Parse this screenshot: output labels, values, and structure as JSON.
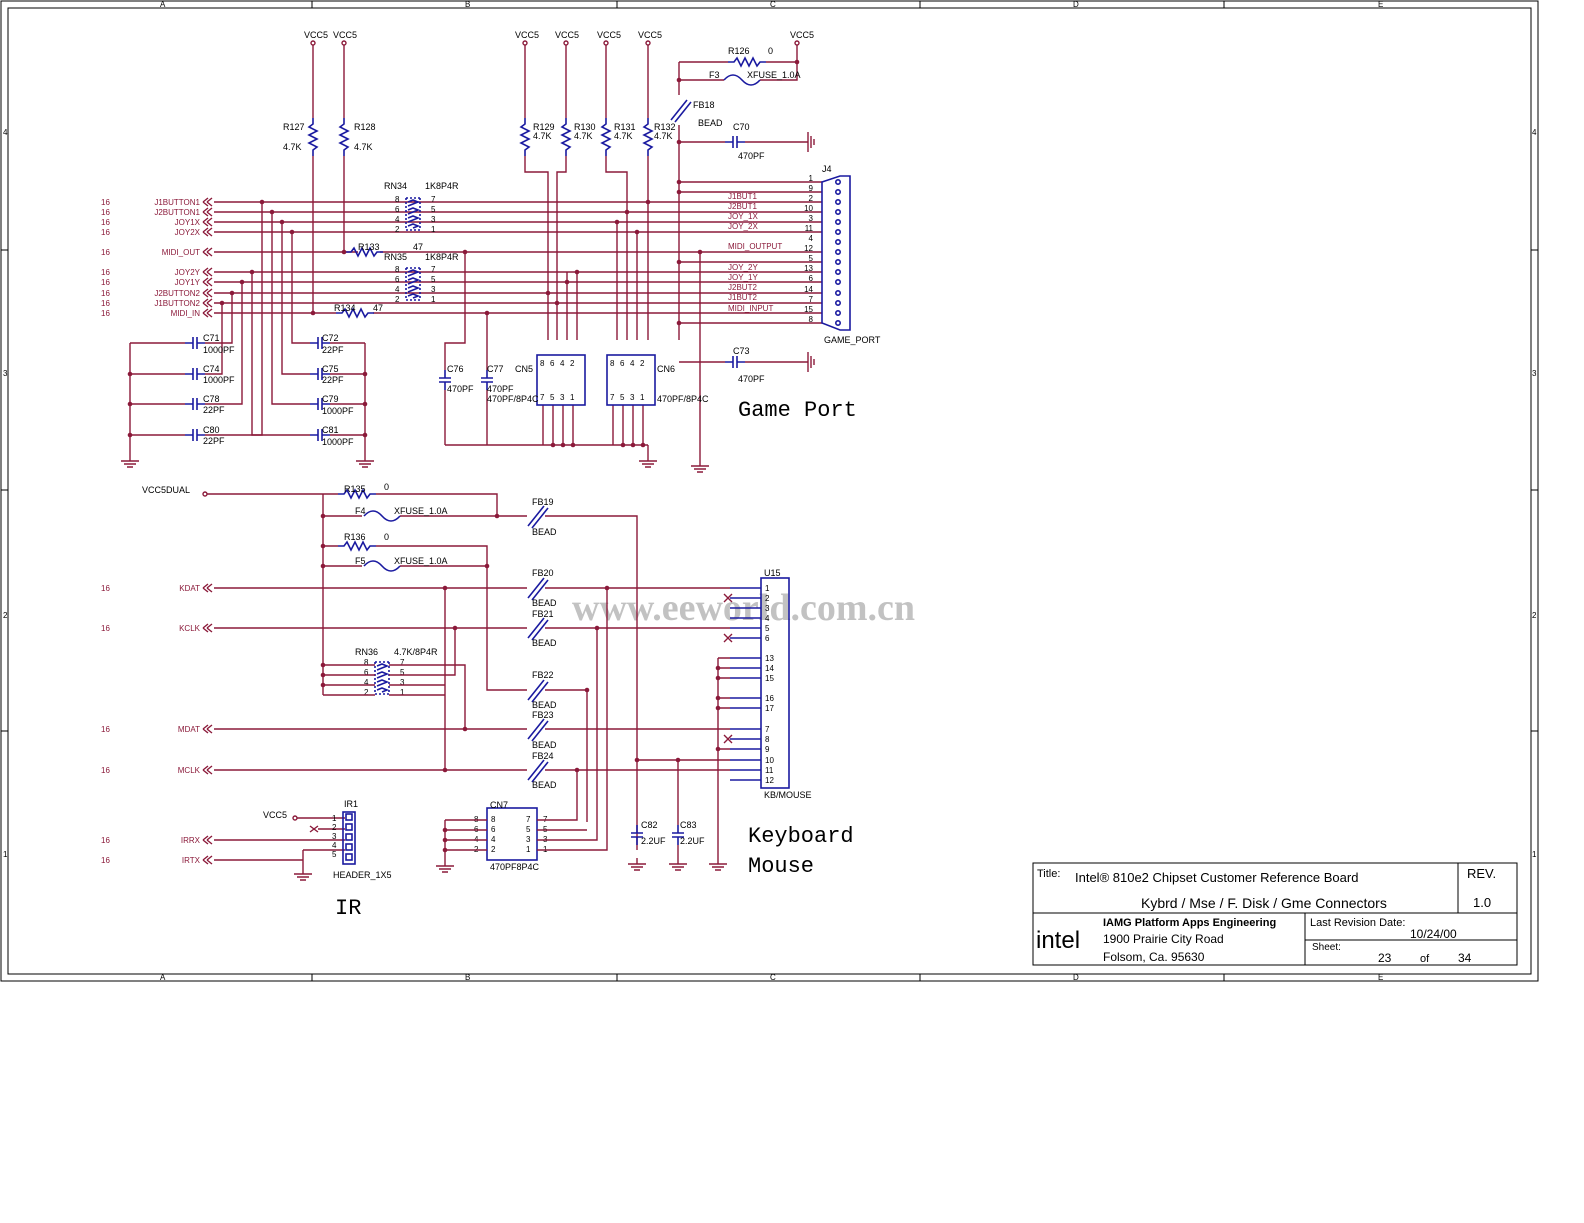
{
  "border": {
    "cols": [
      "A",
      "B",
      "C",
      "D",
      "E"
    ],
    "rows": [
      "4",
      "3",
      "2",
      "1"
    ]
  },
  "watermark": "www.eeworld.com.cn",
  "sections": {
    "game": "Game Port",
    "kb1": "Keyboard",
    "kb2": "Mouse",
    "ir": "IR"
  },
  "supplies": {
    "vcc": "VCC5",
    "vccdual": "VCC5DUAL"
  },
  "sheetref": "16",
  "game_signals": [
    "J1BUTTON1",
    "J2BUTTON1",
    "JOY1X",
    "JOY2X",
    "MIDI_OUT",
    "JOY2Y",
    "JOY1Y",
    "J2BUTTON2",
    "J1BUTTON2",
    "MIDI_IN"
  ],
  "kb_signals": [
    "KDAT",
    "KCLK",
    "MDAT",
    "MCLK"
  ],
  "ir_signals": [
    "IRRX",
    "IRTX"
  ],
  "j4": {
    "ref": "J4",
    "name": "GAME_PORT",
    "pins": [
      "1",
      "9",
      "2",
      "10",
      "3",
      "11",
      "4",
      "12",
      "5",
      "13",
      "6",
      "14",
      "7",
      "15",
      "8"
    ],
    "nets": [
      "J1BUT1",
      "J2BUT1",
      "JOY_1X",
      "JOY_2X",
      "MIDI_OUTPUT",
      "JOY_2Y",
      "JOY_1Y",
      "J2BUT2",
      "J1BUT2",
      "MIDI_INPUT"
    ]
  },
  "resistors": {
    "r127": [
      "R127",
      "4.7K"
    ],
    "r128": [
      "R128",
      "4.7K"
    ],
    "r129": [
      "R129",
      "4.7K"
    ],
    "r130": [
      "R130",
      "4.7K"
    ],
    "r131": [
      "R131",
      "4.7K"
    ],
    "r132": [
      "R132",
      "4.7K"
    ],
    "r126": [
      "R126",
      "0"
    ],
    "r133": [
      "R133",
      "47"
    ],
    "r134": [
      "R134",
      "47"
    ],
    "r135": [
      "R135",
      "0"
    ],
    "r136": [
      "R136",
      "0"
    ]
  },
  "networks": {
    "rn34": [
      "RN34",
      "1K8P4R"
    ],
    "rn35": [
      "RN35",
      "1K8P4R"
    ],
    "rn36": [
      "RN36",
      "4.7K/8P4R"
    ]
  },
  "rn_pins_left": [
    "8",
    "6",
    "4",
    "2"
  ],
  "rn_pins_right": [
    "7",
    "5",
    "3",
    "1"
  ],
  "fuses": {
    "f3": [
      "F3",
      "XFUSE_1.0A"
    ],
    "f4": [
      "F4",
      "XFUSE_1.0A"
    ],
    "f5": [
      "F5",
      "XFUSE_1.0A"
    ]
  },
  "beads": {
    "fb18": "FB18",
    "fb19": "FB19",
    "fb20": "FB20",
    "fb21": "FB21",
    "fb22": "FB22",
    "fb23": "FB23",
    "fb24": "FB24",
    "label": "BEAD"
  },
  "caps": {
    "c70": [
      "C70",
      "470PF"
    ],
    "c73": [
      "C73",
      "470PF"
    ],
    "c71": [
      "C71",
      "1000PF"
    ],
    "c74": [
      "C74",
      "1000PF"
    ],
    "c78": [
      "C78",
      "22PF"
    ],
    "c80": [
      "C80",
      "22PF"
    ],
    "c72": [
      "C72",
      "22PF"
    ],
    "c75": [
      "C75",
      "22PF"
    ],
    "c79": [
      "C79",
      "1000PF"
    ],
    "c81": [
      "C81",
      "1000PF"
    ],
    "c76": [
      "C76",
      "470PF"
    ],
    "c77": [
      "C77",
      "470PF"
    ],
    "c82": [
      "C82",
      "2.2UF"
    ],
    "c83": [
      "C83",
      "2.2UF"
    ]
  },
  "capnets": {
    "cn5": [
      "CN5",
      "470PF/8P4C"
    ],
    "cn6": [
      "CN6",
      "470PF/8P4C"
    ],
    "cn7": [
      "CN7",
      "470PF8P4C"
    ]
  },
  "cn_pins_top": [
    "8",
    "6",
    "4",
    "2"
  ],
  "cn_pins_bot": [
    "7",
    "5",
    "3",
    "1"
  ],
  "u15": {
    "ref": "U15",
    "name": "KB/MOUSE",
    "pins": [
      "1",
      "2",
      "3",
      "4",
      "5",
      "6",
      "13",
      "14",
      "15",
      "16",
      "17",
      "7",
      "8",
      "9",
      "10",
      "11",
      "12"
    ]
  },
  "ir1": {
    "ref": "IR1",
    "name": "HEADER_1X5",
    "pins": [
      "1",
      "2",
      "3",
      "4",
      "5"
    ]
  },
  "title_block": {
    "title_label": "Title:",
    "title": "Intel® 810e2 Chipset Customer Reference Board",
    "subtitle": "Kybrd / Mse / F. Disk / Gme Connectors",
    "rev_label": "REV.",
    "rev": "1.0",
    "logo": "intel",
    "org": "IAMG Platform Apps Engineering",
    "addr1": "1900 Prairie City Road",
    "addr2": "Folsom, Ca. 95630",
    "lrd_label": "Last Revision Date:",
    "lrd": "10/24/00",
    "sheet_label": "Sheet:",
    "sheet": "23",
    "of": "of",
    "total": "34"
  },
  "colors": {
    "wire": "#8b1a3a",
    "component": "#1a1aa0",
    "text": "#000000"
  }
}
